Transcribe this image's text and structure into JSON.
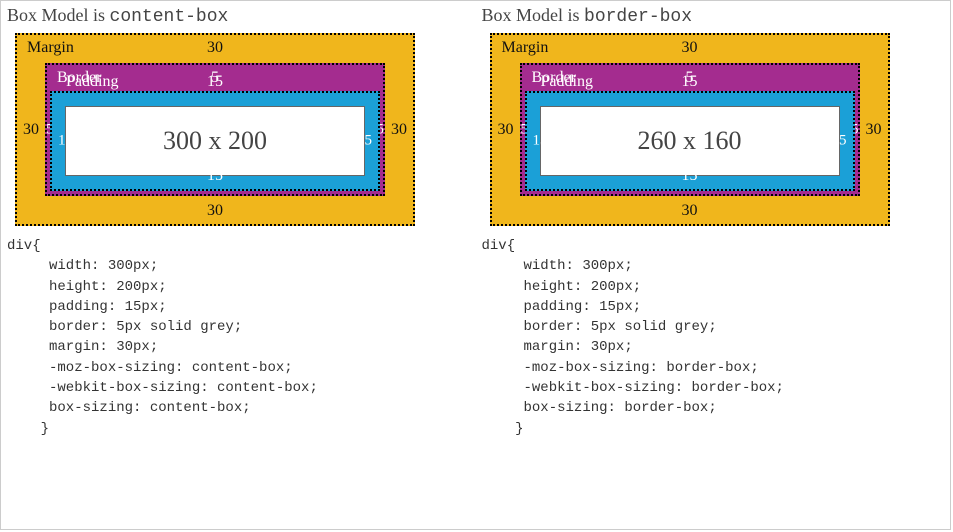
{
  "left": {
    "title_prefix": "Box Model is ",
    "title_value": "content-box",
    "margin": {
      "label": "Margin",
      "value": "30"
    },
    "border": {
      "label": "Border",
      "value": "5"
    },
    "padding": {
      "label": "Padding",
      "value": "15"
    },
    "content": "300 x 200",
    "code": "div{\n     width: 300px;\n     height: 200px;\n     padding: 15px;\n     border: 5px solid grey;\n     margin: 30px;\n     -moz-box-sizing: content-box;\n     -webkit-box-sizing: content-box;\n     box-sizing: content-box;\n    }"
  },
  "right": {
    "title_prefix": "Box Model is ",
    "title_value": "border-box",
    "margin": {
      "label": "Margin",
      "value": "30"
    },
    "border": {
      "label": "Border",
      "value": "5"
    },
    "padding": {
      "label": "Padding",
      "value": "15"
    },
    "content": "260 x 160",
    "code": "div{\n     width: 300px;\n     height: 200px;\n     padding: 15px;\n     border: 5px solid grey;\n     margin: 30px;\n     -moz-box-sizing: border-box;\n     -webkit-box-sizing: border-box;\n     box-sizing: border-box;\n    }"
  },
  "colors": {
    "margin": "#f0b61c",
    "border": "#a42c8f",
    "padding": "#1ba0d7",
    "content": "#ffffff"
  }
}
